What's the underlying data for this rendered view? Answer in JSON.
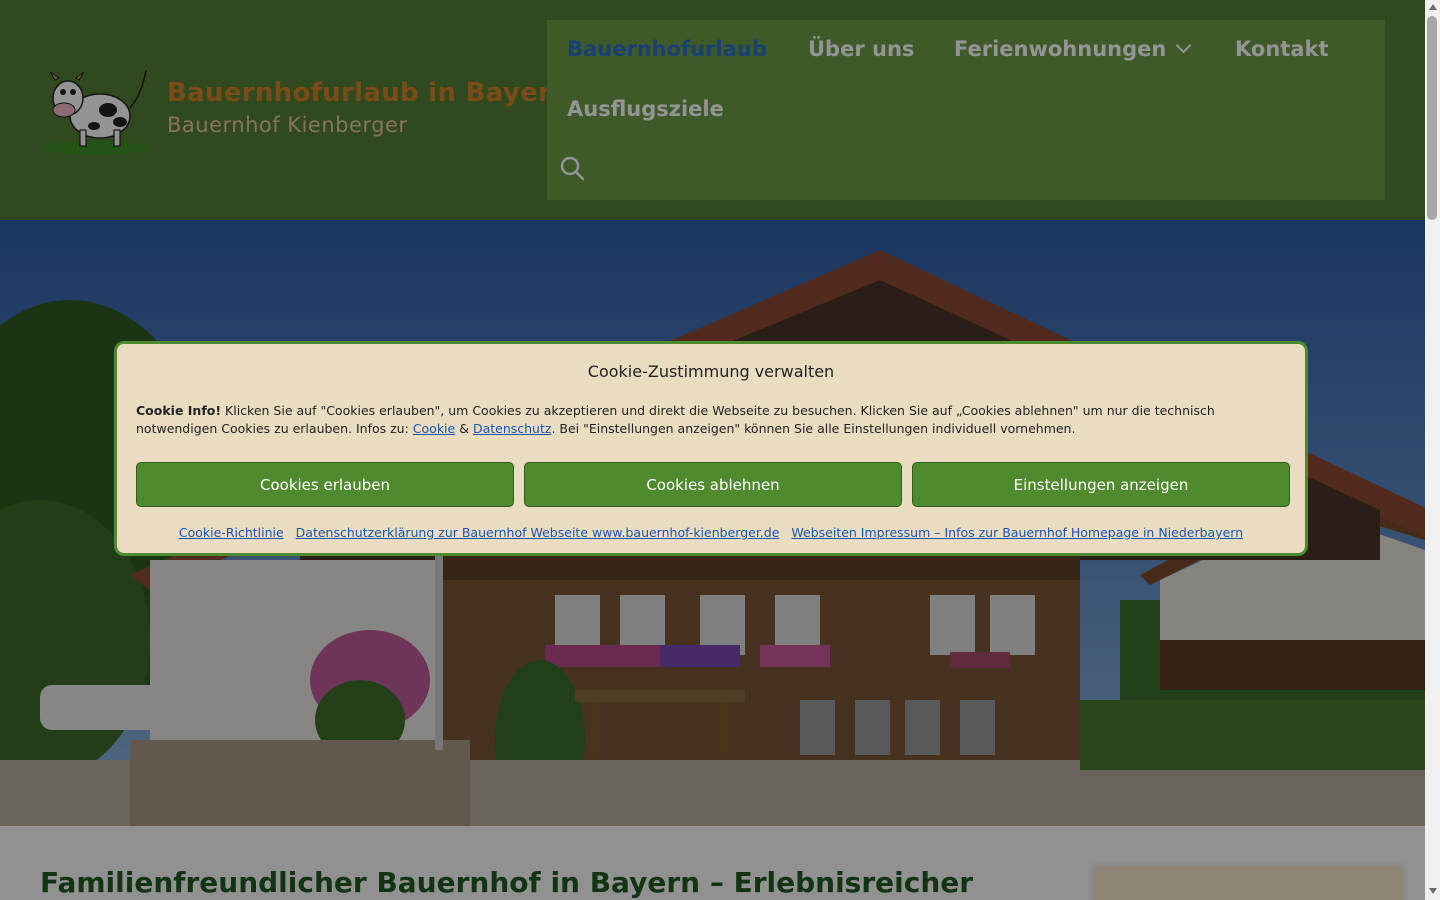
{
  "header": {
    "site_title": "Bauernhofurlaub in Bayern",
    "site_tagline": "Bauernhof Kienberger",
    "logo_icon": "cow-icon"
  },
  "nav": {
    "items": [
      {
        "label": "Bauernhofurlaub",
        "active": true
      },
      {
        "label": "Über uns"
      },
      {
        "label": "Ferienwohnungen",
        "has_dropdown": true
      },
      {
        "label": "Kontakt"
      },
      {
        "label": "Ausflugsziele"
      }
    ],
    "search_icon": "search-icon"
  },
  "hero": {
    "image": "farmhouse-photo"
  },
  "cookie": {
    "title": "Cookie-Zustimmung verwalten",
    "intro_bold": "Cookie Info!",
    "text_part1": " Klicken Sie auf \"Cookies erlauben\", um Cookies zu akzeptieren und direkt die Webseite zu besuchen. Klicken Sie auf „Cookies ablehnen\" um nur die technisch notwendigen Cookies zu erlauben. Infos zu: ",
    "link_cookie": "Cookie",
    "amp": " & ",
    "link_datenschutz": "Datenschutz",
    "text_part2": ". Bei \"Einstellungen anzeigen\" können Sie alle Einstellungen individuell vornehmen.",
    "buttons": {
      "accept": "Cookies erlauben",
      "deny": "Cookies ablehnen",
      "settings": "Einstellungen anzeigen"
    },
    "links": {
      "policy": "Cookie-Richtlinie",
      "privacy": "Datenschutzerklärung zur Bauernhof Webseite www.bauernhof-kienberger.de",
      "imprint": "Webseiten Impressum – Infos zur Bauernhof Homepage in Niederbayern"
    }
  },
  "content": {
    "heading": "Familienfreundlicher Bauernhof in Bayern – Erlebnisreicher"
  },
  "colors": {
    "header_bg": "#547e35",
    "nav_bg": "#6a9c45",
    "accent_green": "#4f8a2f",
    "title_orange": "#d4822a",
    "active_nav": "#2a6fc9",
    "cookie_bg": "#e9dcc0",
    "heading_green": "#1f5a1f"
  }
}
